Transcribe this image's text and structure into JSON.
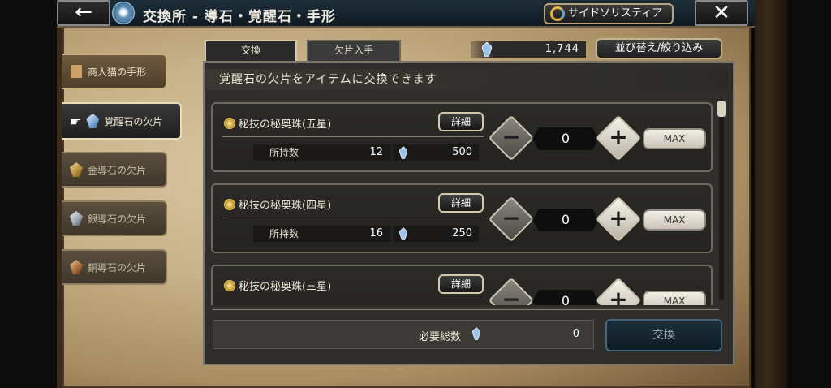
{
  "header": {
    "title": "交換所 - 導石・覚醒石・手形",
    "side_button_label": "サイドソリスティア",
    "back_icon": "←",
    "close_icon": "✕"
  },
  "side_tabs": [
    {
      "label": "商人猫の手形",
      "icon": "scroll-icon",
      "state": "normal"
    },
    {
      "label": "覚醒石の欠片",
      "icon": "crystal-icon",
      "state": "active"
    },
    {
      "label": "金導石の欠片",
      "icon": "gold-stone-icon",
      "state": "inactive"
    },
    {
      "label": "銀導石の欠片",
      "icon": "silver-stone-icon",
      "state": "inactive"
    },
    {
      "label": "銅導石の欠片",
      "icon": "copper-stone-icon",
      "state": "inactive"
    }
  ],
  "top_tabs": [
    {
      "label": "交換",
      "active": true
    },
    {
      "label": "欠片入手",
      "active": false
    }
  ],
  "currency": {
    "value": "1,744",
    "icon": "crystal-icon"
  },
  "sort_button_label": "並び替え/絞り込み",
  "panel_header": "覚醒石の欠片をアイテムに交換できます",
  "items": [
    {
      "name": "秘技の秘奥珠(五星)",
      "detail_label": "詳細",
      "owned_label": "所持数",
      "owned": "12",
      "cost": "500",
      "quantity": "0",
      "max_label": "MAX"
    },
    {
      "name": "秘技の秘奥珠(四星)",
      "detail_label": "詳細",
      "owned_label": "所持数",
      "owned": "16",
      "cost": "250",
      "quantity": "0",
      "max_label": "MAX"
    },
    {
      "name": "秘技の秘奥珠(三星)",
      "detail_label": "詳細",
      "owned_label": "所持数",
      "owned": "",
      "cost": "",
      "quantity": "0",
      "max_label": "MAX"
    }
  ],
  "buttons": {
    "minus": "−",
    "plus": "+"
  },
  "footer": {
    "total_label": "必要総数",
    "total_value": "0",
    "exchange_label": "交換"
  },
  "colors": {
    "header_bg": "#0f1a22",
    "parchment": "#c9b38a",
    "panel_bg": "#2f2e2b",
    "exchange_disabled": "#0f1c25"
  }
}
